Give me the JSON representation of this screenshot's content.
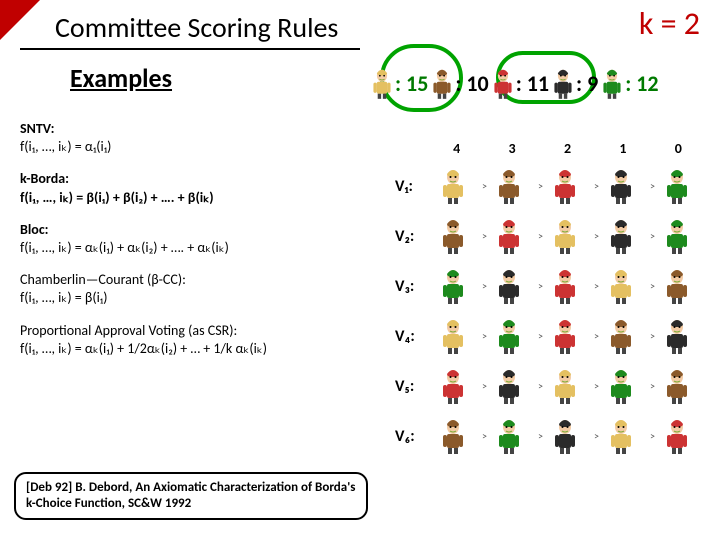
{
  "title": "Committee Scoring Rules",
  "k_equals": "k = 2",
  "examples": "Examples",
  "scores": {
    "s1": ": 15",
    "s2": ": 10",
    "s3": ": 11",
    "s4": ": 9",
    "s5": ": 12"
  },
  "rules": {
    "sntv_title": "SNTV:",
    "sntv_body": "f(i₁, …, iₖ) = α₁(i₁)",
    "kborda_title": "k-Borda:",
    "kborda_body": "f(i₁, …, iₖ) = β(i₁) + β(i₂) + …. + β(iₖ)",
    "bloc_title": "Bloc:",
    "bloc_body": "f(i₁, …, iₖ) = αₖ(i₁) + αₖ(i₂) + …. + αₖ(iₖ)",
    "cc_title": "Chamberlin—Courant (β-CC):",
    "cc_body": "f(i₁, …, iₖ) = β(i₁)",
    "pav_title": "Proportional Approval Voting (as CSR):",
    "pav_body": "f(i₁, …, iₖ) = αₖ(i₁) + 1/2αₖ(i₂) + … + 1/k αₖ(iₖ)"
  },
  "cite": "[Deb 92] B. Debord, An Axiomatic Characterization of Borda's k-Choice Function, SC&W 1992",
  "col_headers": [
    "4",
    "3",
    "2",
    "1",
    "0"
  ],
  "voters": [
    "V₁:",
    "V₂:",
    "V₃:",
    "V₄:",
    "V₅:",
    "V₆:"
  ],
  "candidates": {
    "ids": [
      "blond",
      "brown",
      "red",
      "dark",
      "green"
    ],
    "colors": {
      "blond": "#e4c061",
      "brown": "#8b5a2b",
      "red": "#c33",
      "dark": "#2b2b2b",
      "green": "#1d8a1d"
    }
  },
  "grid": [
    [
      "blond",
      "brown",
      "red",
      "dark",
      "green"
    ],
    [
      "brown",
      "red",
      "blond",
      "dark",
      "green"
    ],
    [
      "green",
      "dark",
      "red",
      "blond",
      "brown"
    ],
    [
      "blond",
      "green",
      "red",
      "brown",
      "dark"
    ],
    [
      "red",
      "dark",
      "blond",
      "green",
      "brown"
    ],
    [
      "brown",
      "green",
      "dark",
      "blond",
      "red"
    ]
  ],
  "sep": ">"
}
